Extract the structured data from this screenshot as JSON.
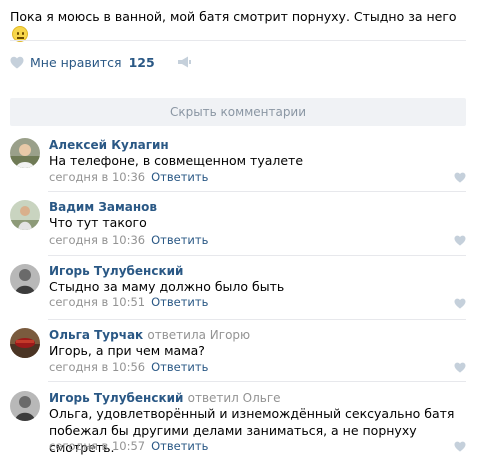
{
  "post": {
    "text": "Пока я моюсь в ванной, мой батя смотрит порнуху. Стыдно за него",
    "emoji": "confused-face"
  },
  "likes": {
    "label": "Мне нравится",
    "count": "125"
  },
  "hide_comments_label": "Скрыть комментарии",
  "colors": {
    "link": "#2a5885",
    "muted": "#939393",
    "divider": "#e7e8ec",
    "bar_bg": "#f0f2f5"
  },
  "comments": [
    {
      "author": "Алексей Кулагин",
      "reply_to": "",
      "text": "На телефоне, в совмещенном туалете",
      "time": "сегодня в 10:36",
      "reply_label": "Ответить"
    },
    {
      "author": "Вадим Заманов",
      "reply_to": "",
      "text": "Что тут такого",
      "time": "сегодня в 10:36",
      "reply_label": "Ответить"
    },
    {
      "author": "Игорь Тулубенский",
      "reply_to": "",
      "text": "Стыдно за маму должно было быть",
      "time": "сегодня в 10:51",
      "reply_label": "Ответить"
    },
    {
      "author": "Ольга Турчак",
      "reply_to": "ответила Игорю",
      "text": "Игорь, а при чем мама?",
      "time": "сегодня в 10:56",
      "reply_label": "Ответить"
    },
    {
      "author": "Игорь Тулубенский",
      "reply_to": "ответил Ольге",
      "text": "Ольга, удовлетворённый и изнемождённый сексуально батя побежал бы другими делами заниматься, а не порнуху смотреть.",
      "time": "сегодня в 10:57",
      "reply_label": "Ответить"
    }
  ]
}
